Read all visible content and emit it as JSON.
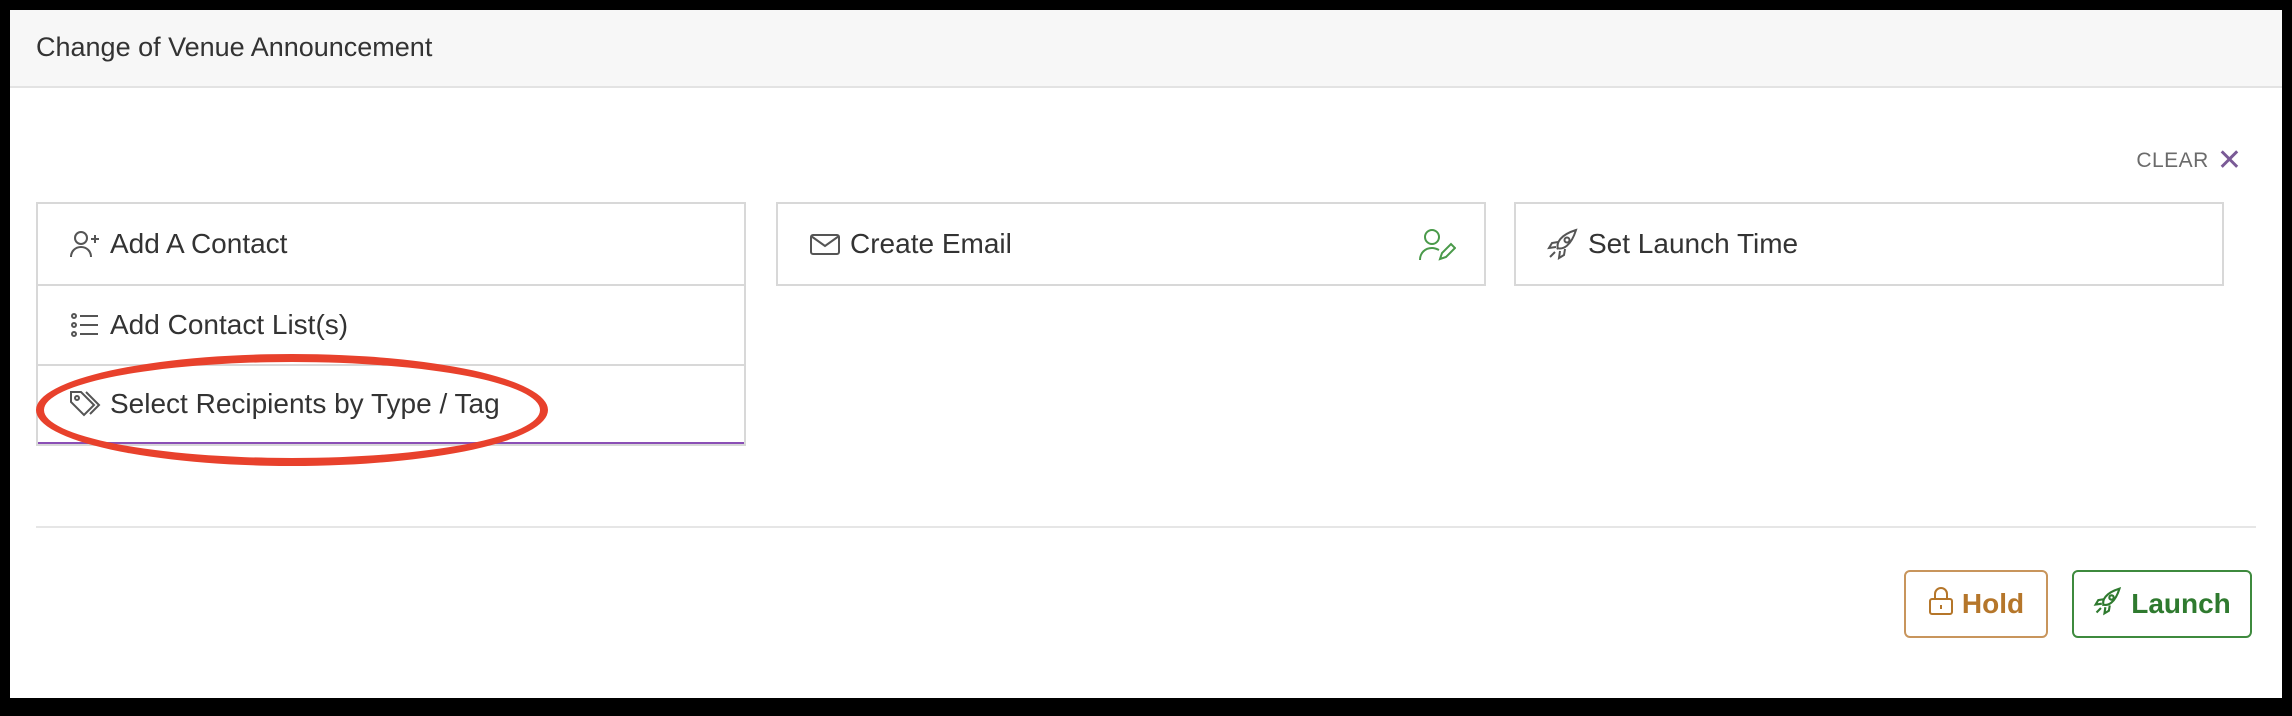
{
  "header": {
    "title": "Change of Venue Announcement"
  },
  "clear": {
    "label": "CLEAR",
    "icon": "close-icon"
  },
  "recipients": {
    "items": [
      {
        "label": "Add A Contact",
        "icon": "user-plus-icon"
      },
      {
        "label": "Add Contact List(s)",
        "icon": "list-icon"
      },
      {
        "label": "Select Recipients by Type / Tag",
        "icon": "tags-icon"
      }
    ]
  },
  "email": {
    "label": "Create Email",
    "icon": "envelope-icon",
    "status_icon": "user-edit-icon"
  },
  "launch_time": {
    "label": "Set Launch Time",
    "icon": "rocket-icon"
  },
  "actions": {
    "hold_label": "Hold",
    "launch_label": "Launch"
  },
  "colors": {
    "accent_purple": "#7a5a96",
    "hold": "#b5762a",
    "launch": "#2f7a2f",
    "annotation": "#e8412c"
  }
}
